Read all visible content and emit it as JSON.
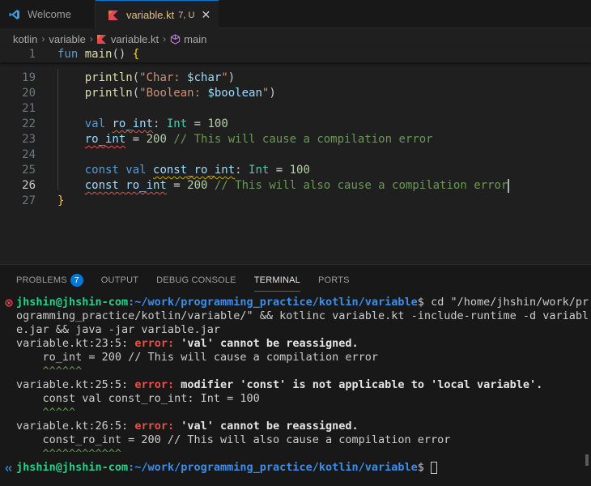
{
  "tabs": {
    "welcome": {
      "label": "Welcome",
      "icon": "vscode-logo-icon"
    },
    "file": {
      "label": "variable.kt",
      "status": "7, U",
      "icon": "kotlin-file-icon",
      "close": "✕"
    }
  },
  "breadcrumb": {
    "items": [
      "kotlin",
      "variable",
      "variable.kt",
      "main"
    ],
    "separator": "›"
  },
  "editor": {
    "lines": [
      {
        "num": "1",
        "tokens": [
          [
            "kw",
            "fun "
          ],
          [
            "fn",
            "main"
          ],
          [
            "p",
            "() "
          ],
          [
            "brace",
            "{"
          ]
        ]
      },
      {
        "num": "19",
        "tokens": [
          [
            "fn",
            "    println"
          ],
          [
            "p",
            "("
          ],
          [
            "str",
            "\"Char: "
          ],
          [
            "var",
            "$char"
          ],
          [
            "str",
            "\""
          ],
          [
            "p",
            ")"
          ]
        ]
      },
      {
        "num": "20",
        "tokens": [
          [
            "fn",
            "    println"
          ],
          [
            "p",
            "("
          ],
          [
            "str",
            "\"Boolean: "
          ],
          [
            "var",
            "$boolean"
          ],
          [
            "str",
            "\""
          ],
          [
            "p",
            ")"
          ]
        ]
      },
      {
        "num": "21",
        "tokens": []
      },
      {
        "num": "22",
        "tokens": [
          [
            "kw",
            "    val "
          ],
          [
            "varsq",
            "ro_int"
          ],
          [
            "p",
            ": "
          ],
          [
            "type",
            "Int"
          ],
          [
            "p",
            " = "
          ],
          [
            "num",
            "100"
          ]
        ]
      },
      {
        "num": "23",
        "tokens": [
          [
            "varsq",
            "    ro_int"
          ],
          [
            "p",
            " = "
          ],
          [
            "num",
            "200"
          ],
          [
            "cmt",
            " // This will cause a compilation error"
          ]
        ]
      },
      {
        "num": "24",
        "tokens": []
      },
      {
        "num": "25",
        "tokens": [
          [
            "kw",
            "    const "
          ],
          [
            "kw",
            "val "
          ],
          [
            "varsq",
            "const_ro_int"
          ],
          [
            "p",
            ": "
          ],
          [
            "type",
            "Int"
          ],
          [
            "p",
            " = "
          ],
          [
            "num",
            "100"
          ]
        ]
      },
      {
        "num": "26",
        "tokens": [
          [
            "varsq",
            "    const ro_int"
          ],
          [
            "p",
            " = "
          ],
          [
            "num",
            "200"
          ],
          [
            "cmt",
            " // This will also cause a compilation error"
          ]
        ]
      },
      {
        "num": "27",
        "tokens": [
          [
            "brace",
            "}"
          ]
        ]
      }
    ]
  },
  "panel": {
    "tabs": [
      "PROBLEMS",
      "OUTPUT",
      "DEBUG CONSOLE",
      "TERMINAL",
      "PORTS"
    ],
    "problems_count": "7",
    "active_tab": "TERMINAL"
  },
  "terminal": {
    "prompt_user": "jhshin@jhshin-com",
    "prompt_path": ":~/work/programming_practice/kotlin/variable",
    "prompt_symbol": "$",
    "command_l1": " cd \"/home/jhshin/work/pr",
    "command_l2": "ogramming_practice/kotlin/variable/\" && kotlinc variable.kt -include-runtime -d variabl",
    "command_l3": "e.jar && java -jar variable.jar",
    "errors": [
      {
        "loc": "variable.kt:23:5: ",
        "label": "error:",
        "msg": " 'val' cannot be reassigned.",
        "code": "    ro_int = 200 // This will cause a compilation error",
        "caret": "    ^^^^^^"
      },
      {
        "loc": "variable.kt:25:5: ",
        "label": "error:",
        "msg": " modifier 'const' is not applicable to 'local variable'.",
        "code": "    const val const_ro_int: Int = 100",
        "caret": "    ^^^^^"
      },
      {
        "loc": "variable.kt:26:5: ",
        "label": "error:",
        "msg": " 'val' cannot be reassigned.",
        "code": "    const_ro_int = 200 // This will also cause a compilation error",
        "caret": "    ^^^^^^^^^^^^"
      }
    ]
  }
}
